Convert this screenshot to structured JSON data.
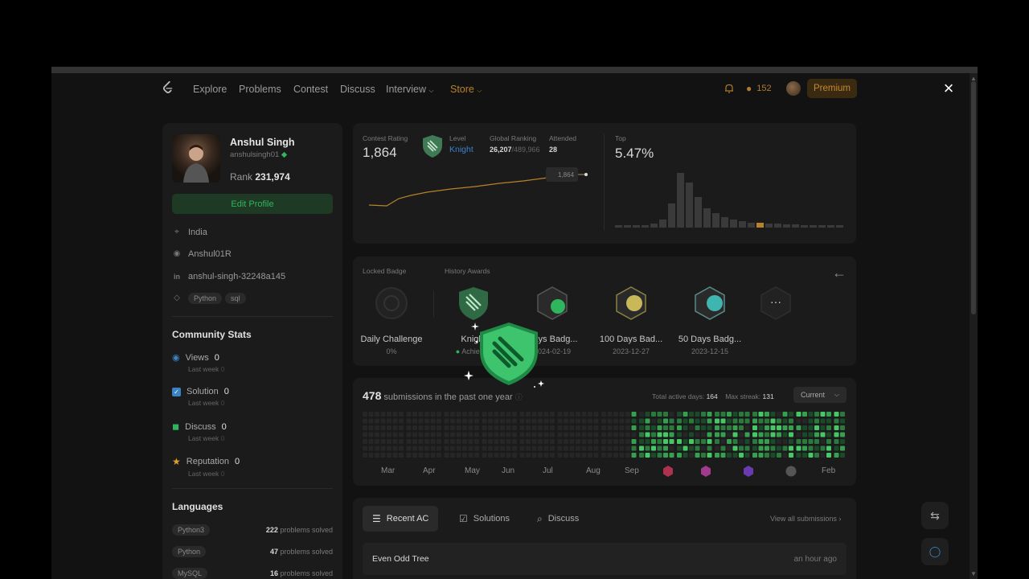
{
  "nav": {
    "links": [
      "Explore",
      "Problems",
      "Contest",
      "Discuss",
      "Interview",
      "Store"
    ],
    "streak": "152",
    "premium": "Premium",
    "close": "×"
  },
  "profile": {
    "name": "Anshul Singh",
    "handle": "anshulsingh01",
    "rank_label": "Rank",
    "rank_value": "231,974",
    "edit_label": "Edit Profile",
    "location": "India",
    "github": "Anshul01R",
    "linkedin": "anshul-singh-32248a145",
    "skills": [
      "Python",
      "sql"
    ]
  },
  "community": {
    "title": "Community Stats",
    "items": [
      {
        "label": "Views",
        "value": "0",
        "sub": "Last week",
        "subval": "0"
      },
      {
        "label": "Solution",
        "value": "0",
        "sub": "Last week",
        "subval": "0"
      },
      {
        "label": "Discuss",
        "value": "0",
        "sub": "Last week",
        "subval": "0"
      },
      {
        "label": "Reputation",
        "value": "0",
        "sub": "Last week",
        "subval": "0"
      }
    ]
  },
  "languages": {
    "title": "Languages",
    "items": [
      {
        "name": "Python3",
        "count": "222",
        "suffix": "problems solved"
      },
      {
        "name": "Python",
        "count": "47",
        "suffix": "problems solved"
      },
      {
        "name": "MySQL",
        "count": "16",
        "suffix": "problems solved"
      }
    ]
  },
  "rating": {
    "contest_label": "Contest Rating",
    "contest_value": "1,864",
    "level_label": "Level",
    "level_value": "Knight",
    "global_label": "Global Ranking",
    "global_value": "26,207",
    "global_total": "/489,966",
    "attended_label": "Attended",
    "attended_value": "28",
    "top_label": "Top",
    "top_value": "5.47%",
    "tooltip": "1,864"
  },
  "badges": {
    "locked_label": "Locked Badge",
    "history_label": "History Awards",
    "items": [
      {
        "name": "Daily Challenge",
        "date": "0%"
      },
      {
        "name": "Knight",
        "date": "Achieved"
      },
      {
        "name": "Days Badg...",
        "date": "2024-02-19"
      },
      {
        "name": "100 Days Bad...",
        "date": "2023-12-27"
      },
      {
        "name": "50 Days Badg...",
        "date": "2023-12-15"
      }
    ],
    "more": "···"
  },
  "submissions": {
    "count": "478",
    "label": "submissions in the past one year",
    "active_label": "Total active days:",
    "active_value": "164",
    "streak_label": "Max streak:",
    "streak_value": "131",
    "dropdown": "Current",
    "months": [
      "Mar",
      "Apr",
      "May",
      "Jun",
      "Jul",
      "Aug",
      "Sep",
      "Feb"
    ]
  },
  "recent": {
    "tabs": [
      "Recent AC",
      "Solutions",
      "Discuss"
    ],
    "view_all": "View all submissions",
    "rows": [
      {
        "title": "Even Odd Tree",
        "time": "an hour ago"
      }
    ]
  },
  "colors": {
    "accent": "#2fb55d",
    "brand": "#c4882f",
    "level": "#3b82c4"
  }
}
